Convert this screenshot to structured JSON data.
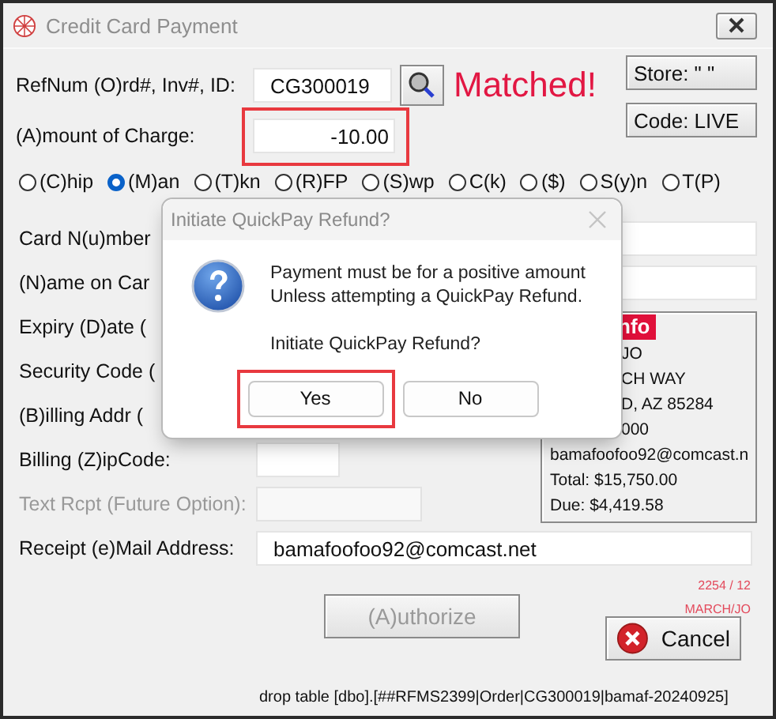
{
  "window": {
    "title": "Credit Card Payment"
  },
  "lookup": {
    "label": "RefNum (O)rd#, Inv#, ID:",
    "value": "CG300019",
    "status": "Matched!"
  },
  "amount": {
    "label": "(A)mount of Charge:",
    "value": "-10.00",
    "highlighted": true
  },
  "side_buttons": [
    "Store: \" \"",
    "Code: LIVE"
  ],
  "payment_modes": [
    {
      "label": "(C)hip",
      "selected": false
    },
    {
      "label": "(M)an",
      "selected": true
    },
    {
      "label": "(T)kn",
      "selected": false
    },
    {
      "label": "(R)FP",
      "selected": false
    },
    {
      "label": "(S)wp",
      "selected": false
    },
    {
      "label": "C(k)",
      "selected": false
    },
    {
      "label": "($)",
      "selected": false
    },
    {
      "label": "S(y)n",
      "selected": false
    },
    {
      "label": "T(P)",
      "selected": false
    }
  ],
  "fields": [
    {
      "label": "Card N(u)mber"
    },
    {
      "label": "(N)ame on Car"
    },
    {
      "label": "Expiry (D)ate ("
    },
    {
      "label": "Security Code ("
    },
    {
      "label": "(B)illing Addr ("
    },
    {
      "label": "Billing (Z)ipCode:"
    },
    {
      "label": "Text Rcpt (Future Option):",
      "disabled": true
    }
  ],
  "info_panel": {
    "heading": "nfo",
    "lines": [
      "JO",
      "CH WAY",
      "D, AZ  85284",
      "000",
      "bamafoofoo92@comcast.n",
      "Total: $15,750.00",
      "Due: $4,419.58"
    ]
  },
  "email": {
    "label": "Receipt (e)Mail Address:",
    "value": "bamafoofoo92@comcast.net"
  },
  "notes": [
    "2254 / 12",
    "MARCH/JO"
  ],
  "authorize": {
    "label": "(A)uthorize",
    "disabled": true
  },
  "cancel": {
    "label": "Cancel"
  },
  "footer": "drop table [dbo].[##RFMS2399|Order|CG300019|bamaf-20240925]",
  "dialog": {
    "title": "Initiate QuickPay Refund?",
    "message": [
      "Payment must be for a positive amount",
      "Unless attempting a QuickPay Refund."
    ],
    "question": "Initiate QuickPay Refund?",
    "buttons": [
      {
        "label": "Yes",
        "highlighted": true
      },
      {
        "label": "No",
        "highlighted": false
      }
    ]
  }
}
